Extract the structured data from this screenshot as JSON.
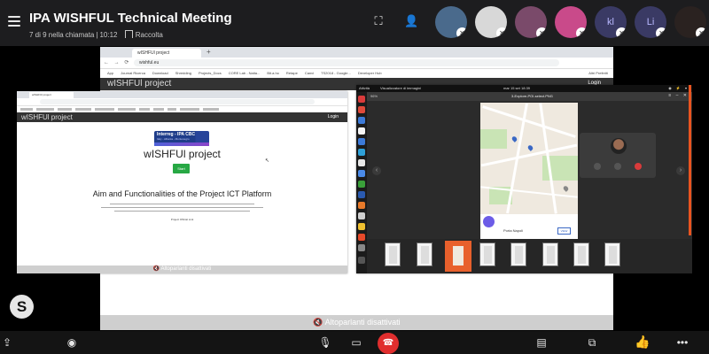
{
  "meeting": {
    "title": "IPA WISHFUL Technical Meeting",
    "participants_info": "7 di 9 nella chiamata",
    "duration": "10:12",
    "collection_label": "Raccolta"
  },
  "participants": [
    {
      "name": "avatar-1",
      "initials": "",
      "bg": "#4a6a8c"
    },
    {
      "name": "avatar-2",
      "initials": "",
      "bg": "#d8d8d8"
    },
    {
      "name": "avatar-3",
      "initials": "",
      "bg": "#7a4a6a"
    },
    {
      "name": "avatar-4",
      "initials": "",
      "bg": "#c94a8a"
    },
    {
      "name": "avatar-kl",
      "initials": "kl",
      "bg": "#3a3a64"
    },
    {
      "name": "avatar-li",
      "initials": "Li",
      "bg": "#3a3a64"
    },
    {
      "name": "avatar-7",
      "initials": "",
      "bg": "#2a2220"
    }
  ],
  "shared_browser": {
    "tab_title": "wISHFUl project",
    "url": "wishful.eu",
    "bookmarks": [
      "App",
      "Journal Ricerca",
      "Download",
      "Shredding",
      "Projects_Docs",
      "CORE Lab - Naita...",
      "Bit.a.ho",
      "Retape",
      "Canvi",
      "TS2018 - Google...",
      "Developer Hub"
    ],
    "bookmarks_right": "Altri Preferiti",
    "site_brand": "wISHFUl project",
    "login": "Login",
    "speaker_notice": "Altoparlanti disattivati"
  },
  "sub_left": {
    "tab_title": "wISHFUl project",
    "brand": "wISHFUl project",
    "login": "Login",
    "logo_line1": "Interreg - IPA CBC",
    "logo_line2": "Italy - Albania - Montenegro",
    "page_title": "wISHFUl project",
    "start_label": "Start",
    "heading": "Aim and Functionalities of the Project ICT Platform",
    "small_text": "Project Official Link",
    "speaker_notice": "Altoparlanti disattivati"
  },
  "sub_right": {
    "activities": "Attività",
    "app_name": "Visualizzatore di immagini",
    "clock": "mar 15 set 18:39",
    "zoom": "96%",
    "file_name": "3-Explore-POI-select.PNG",
    "map_address": "Porta Napoli",
    "map_button": "VIEW"
  },
  "colors": {
    "accent_orange": "#e95420",
    "hangup_red": "#e02e2e",
    "start_green": "#27a844"
  },
  "icons": {
    "menu": "hamburger-icon",
    "screen": "screen-size-icon",
    "add_person": "add-person-icon",
    "share": "share-icon",
    "record": "record-icon",
    "mic_off": "microphone-off-icon",
    "video_off": "video-off-icon",
    "hangup": "hang-up-icon",
    "chat": "chat-icon",
    "switch": "switch-screen-icon",
    "reaction": "thumbs-up-icon",
    "more": "more-icon"
  }
}
